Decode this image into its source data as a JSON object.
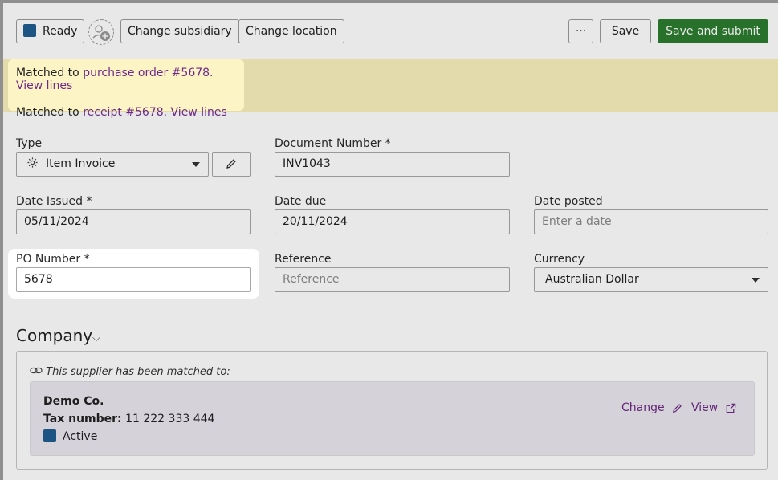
{
  "toolbar": {
    "status_label": "Ready",
    "change_subsidiary": "Change subsidiary",
    "change_location": "Change location",
    "more": "···",
    "save": "Save",
    "save_submit": "Save and submit"
  },
  "banner": {
    "po_prefix": "Matched to ",
    "po_link": "purchase order #5678. View lines",
    "receipt_prefix": "Matched to ",
    "receipt_link": "receipt #5678. View lines"
  },
  "form": {
    "type_label": "Type",
    "type_value": "Item Invoice",
    "docnum_label": "Document Number *",
    "docnum_value": "INV1043",
    "date_issued_label": "Date Issued *",
    "date_issued_value": "05/11/2024",
    "date_due_label": "Date due",
    "date_due_value": "20/11/2024",
    "date_posted_label": "Date posted",
    "date_posted_placeholder": "Enter a date",
    "po_label": "PO Number *",
    "po_value": "5678",
    "reference_label": "Reference",
    "reference_placeholder": "Reference",
    "currency_label": "Currency",
    "currency_value": "Australian Dollar"
  },
  "company": {
    "title": "Company",
    "note": "This supplier has been matched to:",
    "supplier_name": "Demo Co.",
    "tax_label": "Tax number:",
    "tax_value": "11 222 333 444",
    "status": "Active",
    "change": "Change",
    "view": "View"
  },
  "colors": {
    "accent_link": "#6d2a86",
    "primary_button": "#2d7d2f",
    "status_square": "#1f5e91",
    "banner_bg": "#fbf1be"
  }
}
